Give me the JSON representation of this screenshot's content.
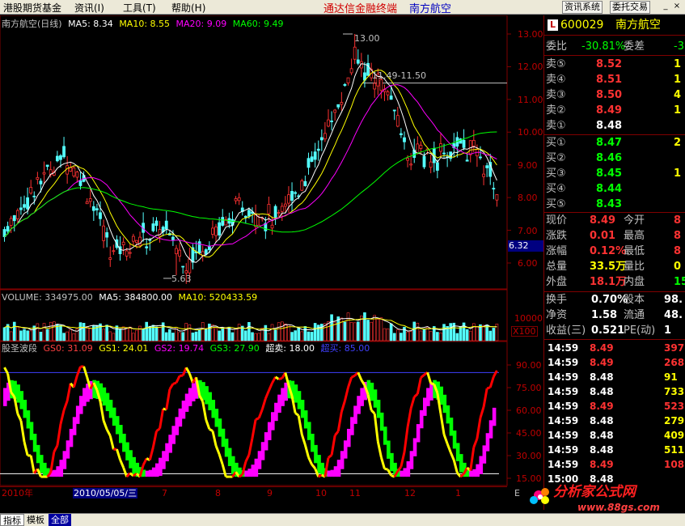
{
  "menu": [
    "港股期货基金",
    "资讯(I)",
    "工具(T)",
    "帮助(H)"
  ],
  "app_title": "通达信金融终端",
  "stock_title": "南方航空",
  "toolbar": {
    "info_btn": "资讯系统",
    "trade_btn": "委托交易"
  },
  "main_chart": {
    "header": {
      "name": "南方航空(日线)",
      "ma5": "MA5: 8.34",
      "ma10": "MA10: 8.55",
      "ma20": "MA20: 9.09",
      "ma60": "MA60: 9.49"
    },
    "y_ticks": [
      "13.00",
      "12.00",
      "11.00",
      "10.00",
      "9.00",
      "8.00",
      "7.00",
      "6.00"
    ],
    "high_label": "13.00",
    "range_label": "11.49-11.50",
    "low_label": "5.63",
    "current_price_tag": "6.32"
  },
  "volume_chart": {
    "header": {
      "volume": "VOLUME: 334975.00",
      "ma5": "MA5: 384800.00",
      "ma10": "MA10: 520433.59"
    },
    "y_tick": "10000",
    "unit": "X100"
  },
  "indicator": {
    "header": {
      "name": "股圣波段",
      "gs0": "GS0: 31.09",
      "gs1": "GS1: 24.01",
      "gs2": "GS2: 19.74",
      "gs3": "GS3: 27.90",
      "overbought": "超卖: 18.00",
      "oversold": "超买: 85.00"
    },
    "y_ticks": [
      "90.00",
      "75.00",
      "60.00",
      "45.00",
      "30.00",
      "15.00"
    ]
  },
  "x_axis": {
    "labels": [
      "2010年",
      "2010/05/05/三",
      "7",
      "8",
      "9",
      "10",
      "11",
      "12",
      "1"
    ],
    "end": "E"
  },
  "quote": {
    "code": "600029",
    "name": "南方航空",
    "badge": "L",
    "weibi_label": "委比",
    "weibi": "-30.81%",
    "weicha_label": "委差",
    "weicha": "-3",
    "asks": [
      {
        "label": "卖⑤",
        "price": "8.52",
        "vol": "1"
      },
      {
        "label": "卖④",
        "price": "8.51",
        "vol": "1"
      },
      {
        "label": "卖③",
        "price": "8.50",
        "vol": "4"
      },
      {
        "label": "卖②",
        "price": "8.49",
        "vol": "1"
      },
      {
        "label": "卖①",
        "price": "8.48",
        "vol": ""
      }
    ],
    "bids": [
      {
        "label": "买①",
        "price": "8.47",
        "vol": "2"
      },
      {
        "label": "买②",
        "price": "8.46",
        "vol": ""
      },
      {
        "label": "买③",
        "price": "8.45",
        "vol": "1"
      },
      {
        "label": "买④",
        "price": "8.44",
        "vol": ""
      },
      {
        "label": "买⑤",
        "price": "8.43",
        "vol": ""
      }
    ],
    "stats": [
      {
        "l1": "现价",
        "v1": "8.49",
        "l2": "今开",
        "v2": "8"
      },
      {
        "l1": "涨跌",
        "v1": "0.01",
        "l2": "最高",
        "v2": "8"
      },
      {
        "l1": "涨幅",
        "v1": "0.12%",
        "l2": "最低",
        "v2": "8"
      },
      {
        "l1": "总量",
        "v1": "33.5万",
        "l2": "量比",
        "v2": "0"
      },
      {
        "l1": "外盘",
        "v1": "18.1万",
        "l2": "内盘",
        "v2": "15."
      }
    ],
    "fund": [
      {
        "l1": "换手",
        "v1": "0.70%",
        "l2": "股本",
        "v2": "98."
      },
      {
        "l1": "净资",
        "v1": "1.58",
        "l2": "流通",
        "v2": "48."
      },
      {
        "l1": "收益(三)",
        "v1": "0.521",
        "l2": "PE(动)",
        "v2": "1"
      }
    ],
    "ticks": [
      {
        "time": "14:59",
        "price": "8.49",
        "vol": "397",
        "up": true
      },
      {
        "time": "14:59",
        "price": "8.49",
        "vol": "268",
        "up": true
      },
      {
        "time": "14:59",
        "price": "8.48",
        "vol": "91",
        "up": false
      },
      {
        "time": "14:59",
        "price": "8.48",
        "vol": "733",
        "up": false
      },
      {
        "time": "14:59",
        "price": "8.49",
        "vol": "523",
        "up": true
      },
      {
        "time": "14:59",
        "price": "8.48",
        "vol": "279",
        "up": false
      },
      {
        "time": "14:59",
        "price": "8.48",
        "vol": "409",
        "up": false
      },
      {
        "time": "14:59",
        "price": "8.48",
        "vol": "511",
        "up": false
      },
      {
        "time": "14:59",
        "price": "8.49",
        "vol": "108",
        "up": true
      },
      {
        "time": "15:00",
        "price": "8.48",
        "vol": "",
        "up": false
      }
    ]
  },
  "tabs": [
    "指标",
    "模板",
    "全部"
  ],
  "watermark": {
    "title": "分析家公式网",
    "url": "www.88gs.com"
  },
  "colors": {
    "up": "#ff3232",
    "down": "#00ff00",
    "ma5": "#ffffff",
    "ma10": "#ffff00",
    "ma20": "#ff00ff",
    "ma60": "#00ff00",
    "axis": "#800000",
    "gs_yellow": "#ffff00",
    "gs_green": "#00ff00",
    "gs_magenta": "#ff00ff",
    "gs_red": "#ff0000"
  }
}
